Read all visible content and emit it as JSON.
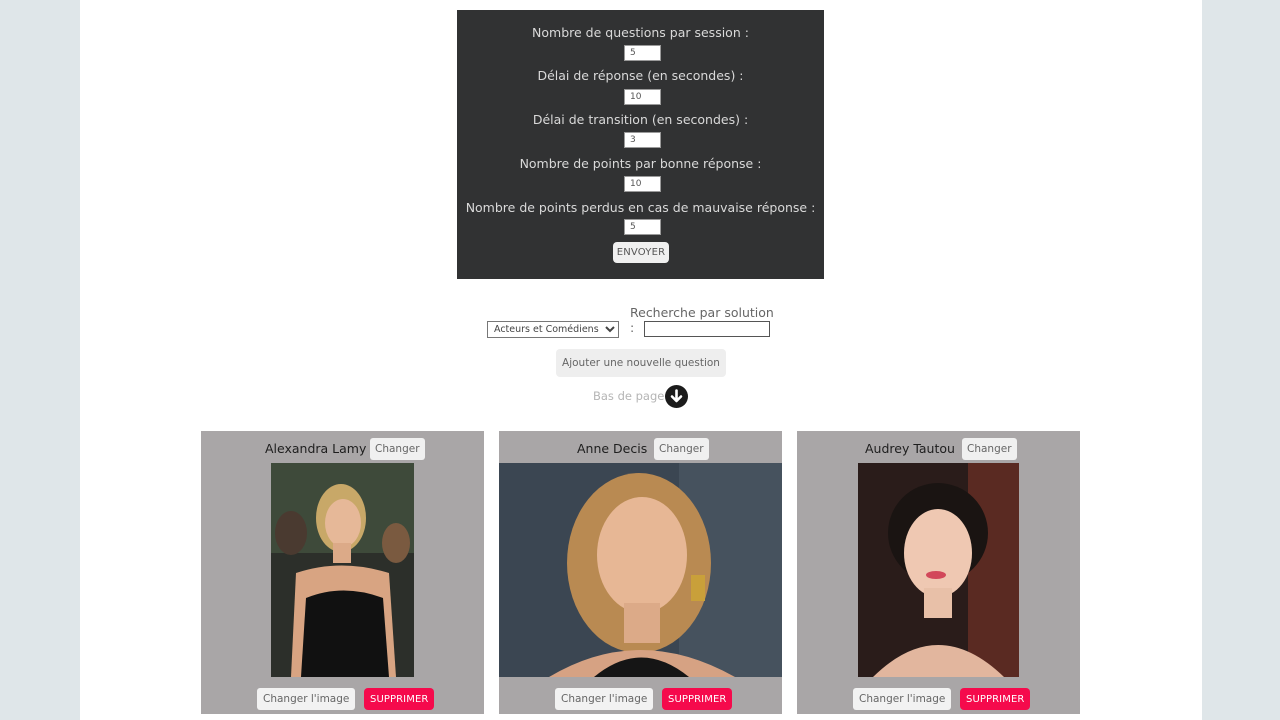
{
  "settings": {
    "questions_label": "Nombre de questions par session :",
    "questions_value": "5",
    "answer_delay_label": "Délai de réponse (en secondes) :",
    "answer_delay_value": "10",
    "transition_delay_label": "Délai de transition (en secondes) :",
    "transition_delay_value": "3",
    "points_good_label": "Nombre de points par bonne réponse :",
    "points_good_value": "10",
    "points_lost_label": "Nombre de points perdus en cas de mauvaise réponse :",
    "points_lost_value": "5",
    "send_label": "ENVOYER"
  },
  "filters": {
    "category_selected": "Acteurs et Comédiens",
    "search_label": "Recherche par solution :",
    "search_value": ""
  },
  "actions": {
    "add_question_label": "Ajouter une nouvelle question",
    "bottom_link_label": "Bas de page",
    "bottom_icon": "arrow-down-circle-icon"
  },
  "cards": [
    {
      "name": "Alexandra Lamy",
      "change_label": "Changer",
      "change_image_label": "Changer l'image",
      "delete_label": "SUPPRIMER"
    },
    {
      "name": "Anne Decis",
      "change_label": "Changer",
      "change_image_label": "Changer l'image",
      "delete_label": "SUPPRIMER"
    },
    {
      "name": "Audrey Tautou",
      "change_label": "Changer",
      "change_image_label": "Changer l'image",
      "delete_label": "SUPPRIMER"
    }
  ],
  "colors": {
    "settings_bg": "#313233",
    "card_bg": "#a9a6a7",
    "delete_bg": "#f50a4c",
    "page_bg": "#dfe6e9"
  }
}
